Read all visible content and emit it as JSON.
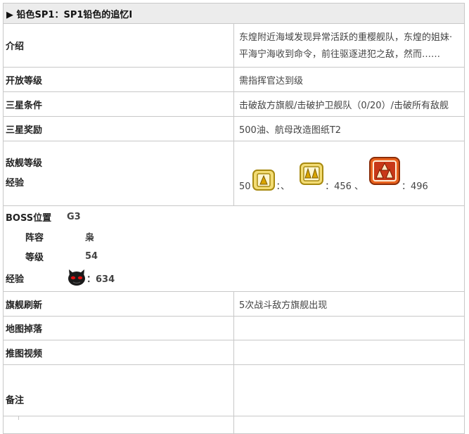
{
  "title": "铅色SP1：SP1铅色的追忆I",
  "title_marker": "▶",
  "rows": {
    "intro": {
      "label": "介绍",
      "value": "东煌附近海域发现异常活跃的重樱舰队，东煌的姐妹·平海宁海收到命令，前往驱逐进犯之敌，然而……"
    },
    "level": {
      "label": "开放等级",
      "value": "需指挥官达到级"
    },
    "star_cond": {
      "label": "三星条件",
      "value": "击破敌方旗舰/击破护卫舰队（0/20）/击破所有敌舰"
    },
    "star_reward": {
      "label": "三星奖励",
      "value": "500油、航母改造图纸T2"
    },
    "enemy": {
      "label_line1": "敌舰等级",
      "label_line2": "经验",
      "exp_prefix": "50",
      "sep1": "：、",
      "val2": "：456 、",
      "val3": "：496"
    },
    "boss": {
      "label": "BOSS位置",
      "pos": "G3",
      "lineup_label": "阵容",
      "lineup": "枭",
      "level_label": "等级",
      "level": "54",
      "exp_label": "经验",
      "exp": "：634"
    },
    "flagship": {
      "label": "旗舰刷新",
      "value": "5次战斗敌方旗舰出现"
    },
    "drops": {
      "label": "地图掉落",
      "value": ""
    },
    "video": {
      "label": "推图视频",
      "value": ""
    },
    "notes": {
      "label": "备注",
      "value": ""
    }
  },
  "colors": {
    "header_bg": "#ececec",
    "border": "#c8c8c8",
    "icon_gold": "#d8b020",
    "icon_red": "#c83818"
  },
  "icons": [
    "rank1-small-fleet-icon",
    "rank2-medium-fleet-icon",
    "rank3-large-fleet-icon",
    "boss-cat-face-icon"
  ]
}
